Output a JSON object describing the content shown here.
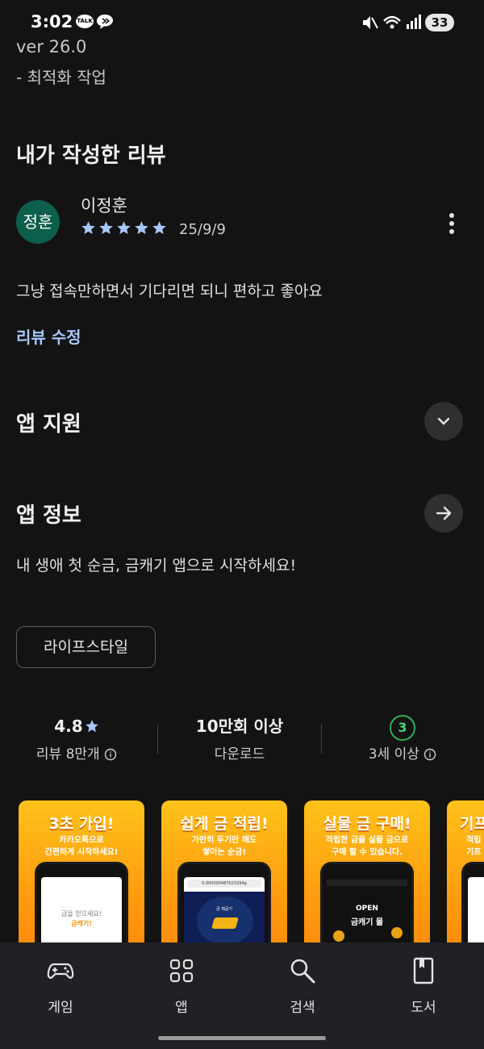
{
  "status_bar": {
    "time": "3:02",
    "talk_badge": "TALK",
    "battery": "33"
  },
  "update": {
    "version": "ver 26.0",
    "note": "- 최적화 작업"
  },
  "my_review": {
    "title": "내가 작성한 리뷰",
    "avatar_text": "정훈",
    "reviewer": "이정훈",
    "rating": 5,
    "date": "25/9/9",
    "text": "그냥 접속만하면서 기다리면 되니 편하고 좋아요",
    "edit_label": "리뷰 수정"
  },
  "app_support": {
    "title": "앱 지원"
  },
  "app_info": {
    "title": "앱 정보",
    "description": "내 생애 첫 순금, 금캐기 앱으로 시작하세요!"
  },
  "category_chip": "라이프스타일",
  "stats": {
    "rating": "4.8",
    "reviews_label": "리뷰 8만개",
    "downloads": "10만회 이상",
    "downloads_label": "다운로드",
    "age_badge": "3",
    "age_label": "3세 이상"
  },
  "screenshots": [
    {
      "headline": "3초 가입!",
      "sub1": "카카오톡으로",
      "sub2": "간편하게 시작하세요!",
      "screen_text1": "금을 얻으세요!",
      "screen_text2": "금캐기!"
    },
    {
      "headline": "쉽게 금 적립!",
      "sub1": "가만히 두기만 해도",
      "sub2": "쌓이는 순금!",
      "screen_text1": "0.000000487023294g",
      "screen_text2": "금 채굴기"
    },
    {
      "headline": "실물 금 구매!",
      "sub1": "적립한 금을 실물 금으로",
      "sub2": "구매 할 수 있습니다.",
      "screen_text1": "OPEN",
      "screen_text2": "금캐기 몰"
    },
    {
      "headline": "기프",
      "sub1": "적립",
      "sub2": "기프"
    }
  ],
  "bottom_nav": {
    "items": [
      {
        "label": "게임",
        "icon": "gamepad-icon"
      },
      {
        "label": "앱",
        "icon": "apps-grid-icon"
      },
      {
        "label": "검색",
        "icon": "search-icon"
      },
      {
        "label": "도서",
        "icon": "book-icon"
      }
    ]
  },
  "colors": {
    "background": "#131313",
    "link": "#a8c7fa",
    "star": "#a8c7fa",
    "avatar": "#0b5f4b",
    "age_badge": "#2fae5a",
    "screenshot_orange": "#ff9d10",
    "nav_background": "#202124"
  }
}
